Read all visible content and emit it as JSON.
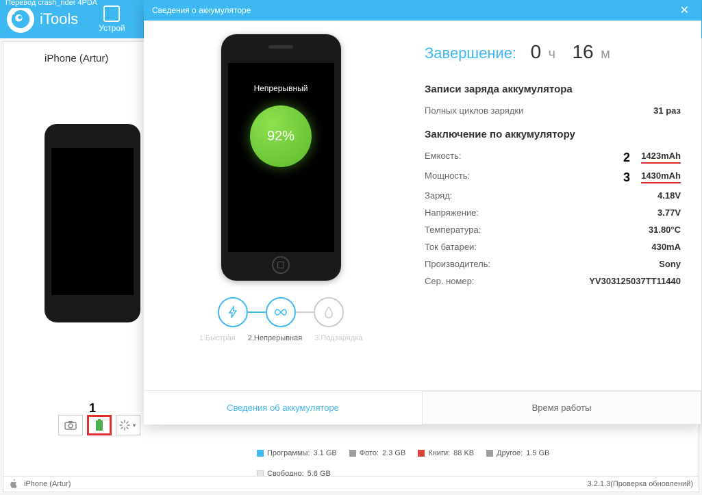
{
  "app": {
    "name": "iTools",
    "translator": "Перевод crash_rider 4PDA",
    "nav_tab": "Устрой"
  },
  "device": {
    "name": "iPhone (Artur)"
  },
  "annotations": {
    "one": "1",
    "two": "2",
    "three": "3"
  },
  "dialog": {
    "title": "Сведения о аккумуляторе",
    "charge_mode": "Непрерывный",
    "charge_percent": "92%",
    "modes": {
      "fast": "1.Быстрая",
      "continuous": "2.Непрерывная",
      "trickle": "3.Подзарядка"
    },
    "completion": {
      "label": "Завершение:",
      "hours": "0",
      "hours_unit": "ч",
      "minutes": "16",
      "minutes_unit": "м"
    },
    "records_title": "Записи заряда аккумулятора",
    "full_cycles_label": "Полных циклов зарядки",
    "full_cycles_value": "31 раз",
    "conclusion_title": "Заключение по аккумулятору",
    "stats": {
      "capacity": {
        "label": "Емкость:",
        "value": "1423mAh"
      },
      "power": {
        "label": "Мощность:",
        "value": "1430mAh"
      },
      "charge": {
        "label": "Заряд:",
        "value": "4.18V"
      },
      "voltage": {
        "label": "Напряжение:",
        "value": "3.77V"
      },
      "temperature": {
        "label": "Температура:",
        "value": "31.80°C"
      },
      "current": {
        "label": "Ток батареи:",
        "value": "430mA"
      },
      "manufacturer": {
        "label": "Производитель:",
        "value": "Sony"
      },
      "serial": {
        "label": "Сер. номер:",
        "value": "YV303125037TT11440"
      }
    },
    "tabs": {
      "info": "Сведения об аккумуляторе",
      "runtime": "Время работы"
    }
  },
  "storage": {
    "apps": {
      "label": "Программы:",
      "value": "3.1 GB",
      "color": "#3eb8f0"
    },
    "photos": {
      "label": "Фото:",
      "value": "2.3 GB",
      "color": "#9e9e9e"
    },
    "books": {
      "label": "Книги:",
      "value": "88 KB",
      "color": "#d9433a"
    },
    "other": {
      "label": "Другое:",
      "value": "1.5 GB",
      "color": "#9e9e9e"
    },
    "free": {
      "label": "Свободно:",
      "value": "5.6 GB",
      "color": "#e8e8e8"
    }
  },
  "statusbar": {
    "device": "iPhone (Artur)",
    "version": "3.2.1.3",
    "update": "(Проверка обновлений)"
  }
}
